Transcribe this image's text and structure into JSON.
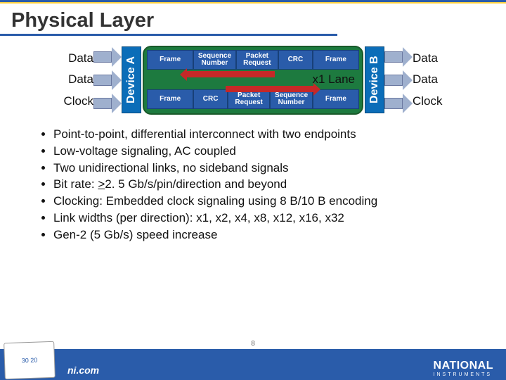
{
  "title": "Physical Layer",
  "left_labels": [
    "Data",
    "Data",
    "Clock"
  ],
  "right_labels": [
    "Data",
    "Data",
    "Clock"
  ],
  "device_a": "Device A",
  "device_b": "Device B",
  "frame_top": [
    "Frame",
    "Sequence\nNumber",
    "Packet\nRequest",
    "CRC",
    "Frame"
  ],
  "frame_bottom": [
    "Frame",
    "CRC",
    "Packet\nRequest",
    "Sequence\nNumber",
    "Frame"
  ],
  "lane_label": "x1 Lane",
  "bullets": [
    "Point-to-point, differential interconnect with two endpoints",
    "Low-voltage signaling, AC coupled",
    "Two unidirectional links, no sideband signals",
    "Bit rate: >2. 5 Gb/s/pin/direction and beyond",
    "Clocking: Embedded clock signaling using 8 B/10 B encoding",
    "Link widths (per direction): x1, x2, x4, x8, x12, x16, x32",
    "Gen-2 (5 Gb/s) speed increase"
  ],
  "page_number": "8",
  "footer_badge": "30 20",
  "footer_url": "ni.com",
  "footer_brand": "NATIONAL",
  "footer_brand_sub": "INSTRUMENTS"
}
